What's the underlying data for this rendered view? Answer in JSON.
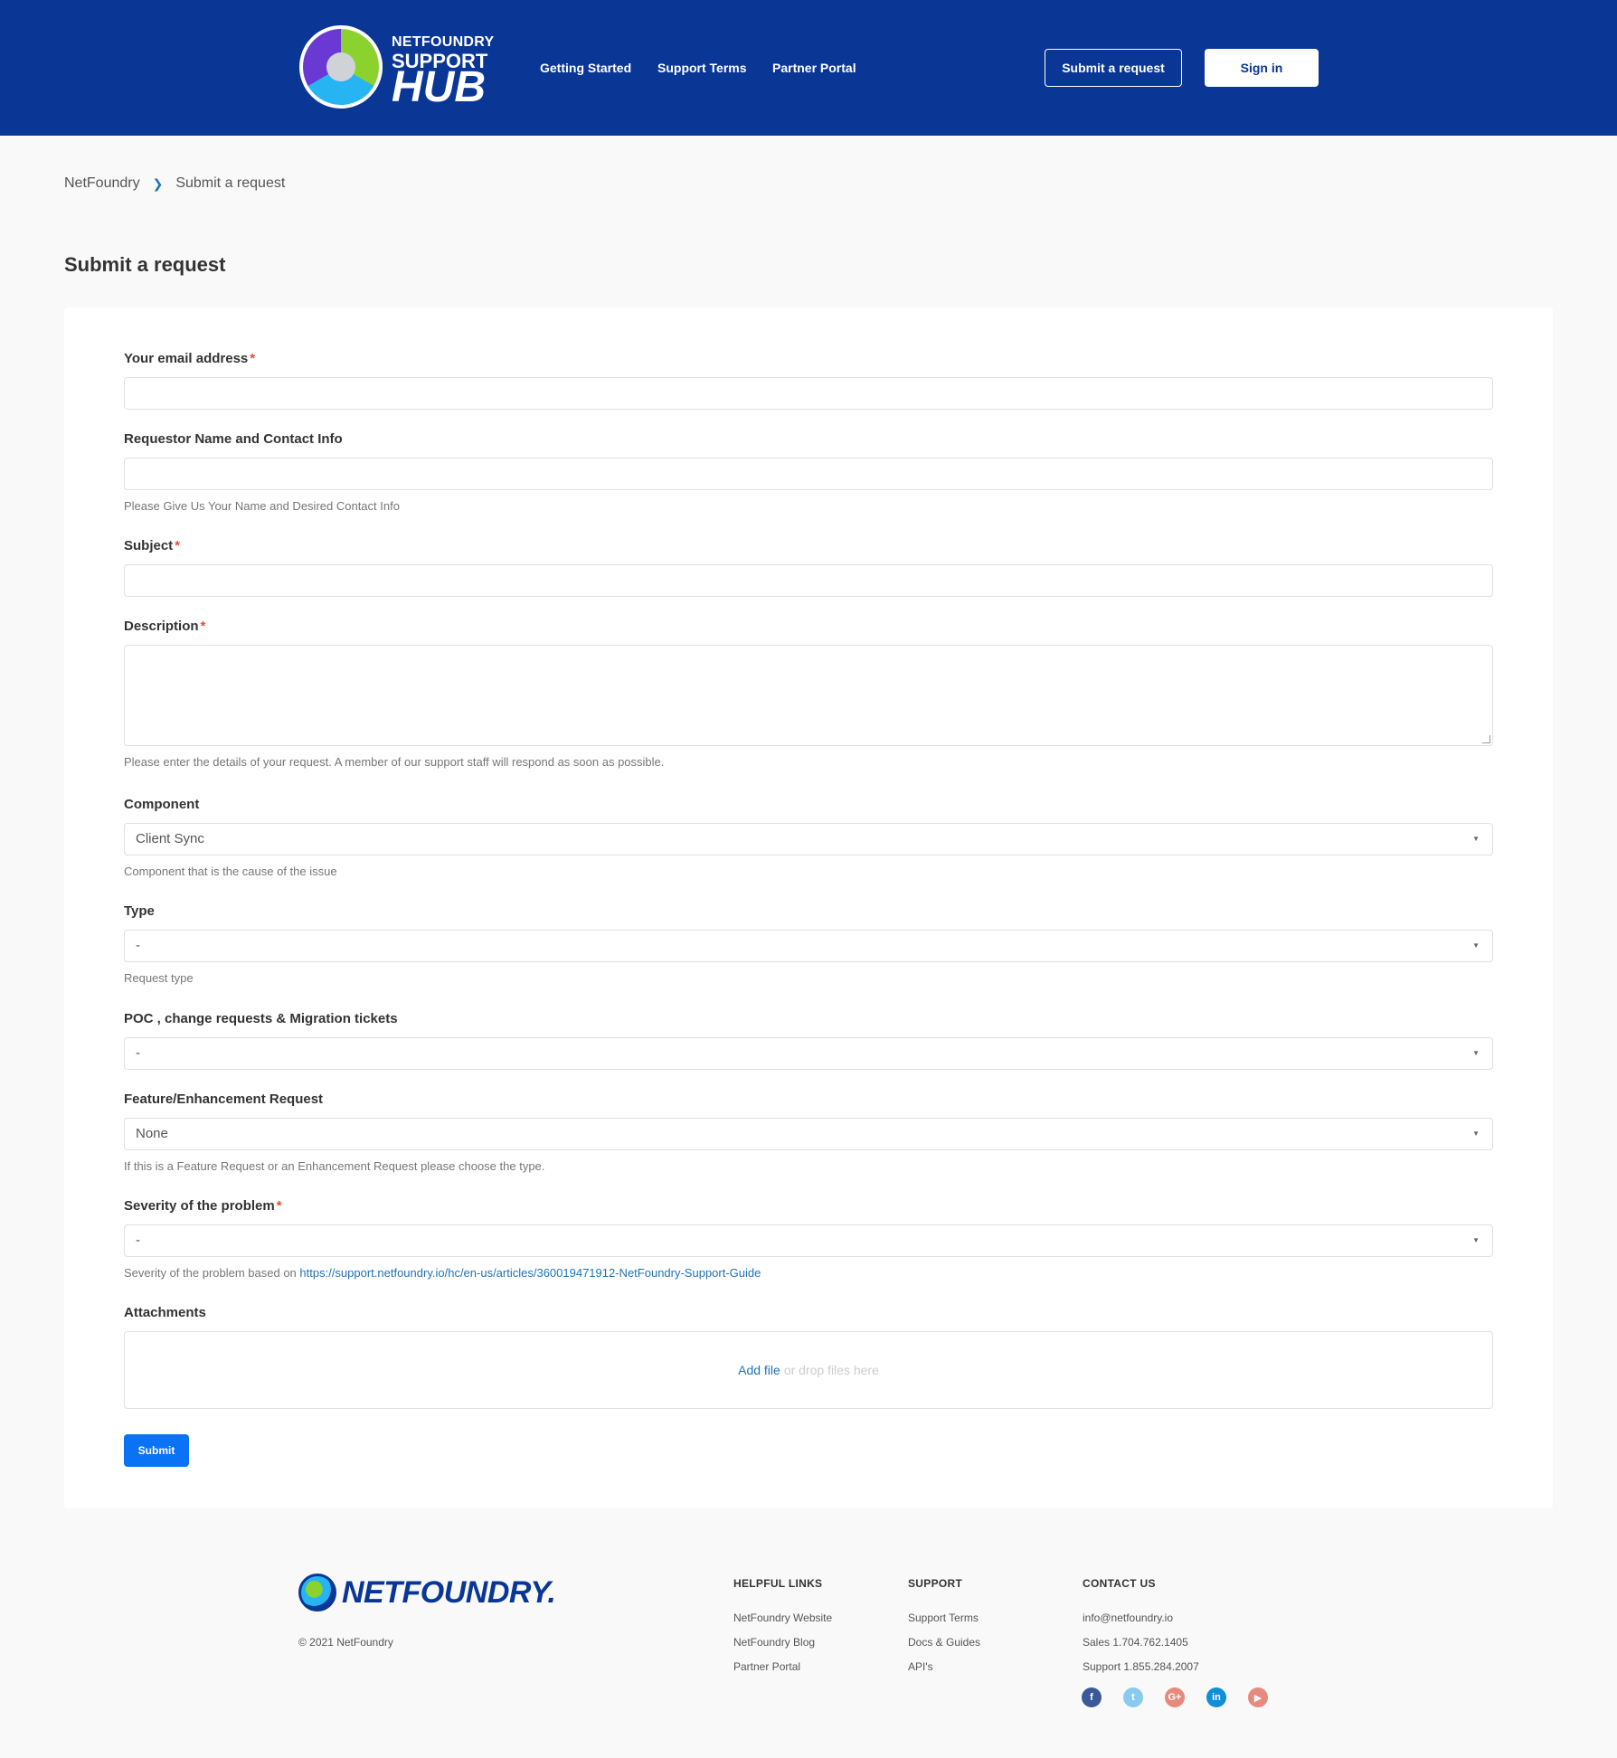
{
  "header": {
    "logo": {
      "line1": "NETFOUNDRY",
      "line2": "SUPPORT",
      "line3": "HUB"
    },
    "nav": [
      "Getting Started",
      "Support Terms",
      "Partner Portal"
    ],
    "submit_request": "Submit a request",
    "sign_in": "Sign in"
  },
  "breadcrumb": {
    "home": "NetFoundry",
    "current": "Submit a request"
  },
  "page_title": "Submit a request",
  "form": {
    "email": {
      "label": "Your email address",
      "required": "*",
      "value": ""
    },
    "requestor": {
      "label": "Requestor Name and Contact Info",
      "hint": "Please Give Us Your Name and Desired Contact Info"
    },
    "subject": {
      "label": "Subject",
      "required": "*"
    },
    "description": {
      "label": "Description",
      "required": "*",
      "hint": "Please enter the details of your request. A member of our support staff will respond as soon as possible."
    },
    "component": {
      "label": "Component",
      "value": "Client Sync",
      "hint": "Component that is the cause of the issue"
    },
    "type": {
      "label": "Type",
      "value": "-",
      "hint": "Request type"
    },
    "poc": {
      "label": "POC , change requests & Migration tickets",
      "value": "-"
    },
    "feature": {
      "label": "Feature/Enhancement Request",
      "value": "None",
      "hint": "If this is a Feature Request or an Enhancement Request please choose the type."
    },
    "severity": {
      "label": "Severity of the problem",
      "required": "*",
      "value": "-",
      "hint_prefix": "Severity of the problem based on",
      "hint_link": "https://support.netfoundry.io/hc/en-us/articles/360019471912-NetFoundry-Support-Guide"
    },
    "attachments": {
      "label": "Attachments",
      "add_file": "Add file",
      "drop": "or drop files here"
    },
    "submit": "Submit"
  },
  "footer": {
    "logo": "NETFOUNDRY.",
    "copyright": "© 2021 NetFoundry",
    "helpful": {
      "title": "HELPFUL LINKS",
      "items": [
        "NetFoundry Website",
        "NetFoundry Blog",
        "Partner Portal"
      ]
    },
    "support": {
      "title": "SUPPORT",
      "items": [
        "Support Terms",
        "Docs & Guides",
        "API's"
      ]
    },
    "contact": {
      "title": "CONTACT US",
      "items": [
        "info@netfoundry.io",
        "Sales 1.704.762.1405",
        "Support 1.855.284.2007"
      ]
    },
    "social": [
      {
        "icon": "facebook-icon",
        "glyph": "f",
        "color": "#3b5998"
      },
      {
        "icon": "twitter-icon",
        "glyph": "t",
        "color": "#8ac9f0"
      },
      {
        "icon": "google-plus-icon",
        "glyph": "G+",
        "color": "#e8897d"
      },
      {
        "icon": "linkedin-icon",
        "glyph": "in",
        "color": "#0e8fd8"
      },
      {
        "icon": "youtube-icon",
        "glyph": "▶",
        "color": "#e8897d"
      }
    ]
  }
}
